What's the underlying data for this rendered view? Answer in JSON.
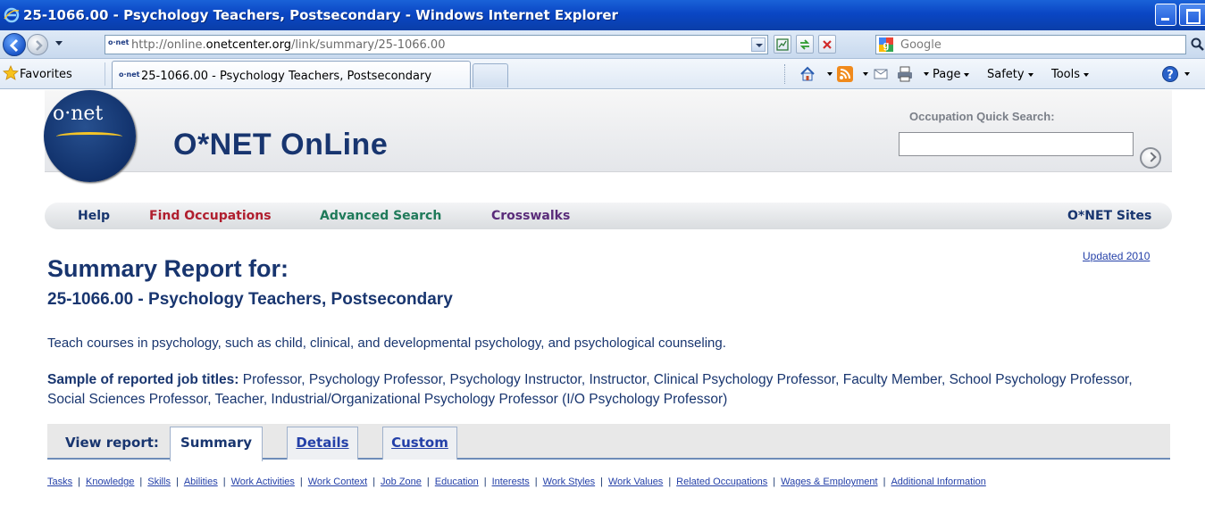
{
  "window": {
    "title": "25-1066.00 - Psychology Teachers, Postsecondary - Windows Internet Explorer"
  },
  "addressbar": {
    "favicon_text": "o·net",
    "url_prefix": "http://online.",
    "url_domain": "onetcenter.org",
    "url_path": "/link/summary/25-1066.00",
    "search_placeholder": "Google"
  },
  "favorites_bar": {
    "favorites_label": "Favorites",
    "tab_title": "25-1066.00 - Psychology Teachers, Postsecondary",
    "commands": {
      "page": "Page",
      "safety": "Safety",
      "tools": "Tools"
    }
  },
  "site": {
    "logo_text": "o·net",
    "title": "O*NET OnLine",
    "quick_search_label": "Occupation Quick Search:",
    "quick_search_value": ""
  },
  "nav": {
    "help": "Help",
    "find_occupations": "Find Occupations",
    "advanced_search": "Advanced Search",
    "crosswalks": "Crosswalks",
    "onet_sites": "O*NET Sites",
    "colors": {
      "help": "#18356f",
      "find_occupations": "#b01e2e",
      "advanced_search": "#1f7a5a",
      "crosswalks": "#5a2c7a",
      "onet_sites": "#18356f"
    }
  },
  "report": {
    "updated": "Updated 2010",
    "heading": "Summary Report for:",
    "occupation": "25-1066.00 - Psychology Teachers, Postsecondary",
    "description": "Teach courses in psychology, such as child, clinical, and developmental psychology, and psychological counseling.",
    "sample_label": "Sample of reported job titles:",
    "sample_titles": "Professor, Psychology Professor, Psychology Instructor, Instructor, Clinical Psychology Professor, Faculty Member, School Psychology Professor, Social Sciences Professor, Teacher, Industrial/Organizational Psychology Professor (I/O Psychology Professor)"
  },
  "view_report": {
    "label": "View report:",
    "tabs": [
      "Summary",
      "Details",
      "Custom"
    ],
    "active": "Summary"
  },
  "section_links": [
    "Tasks",
    "Knowledge",
    "Skills",
    "Abilities",
    "Work Activities",
    "Work Context",
    "Job Zone",
    "Education",
    "Interests",
    "Work Styles",
    "Work Values",
    "Related Occupations",
    "Wages & Employment",
    "Additional Information"
  ]
}
